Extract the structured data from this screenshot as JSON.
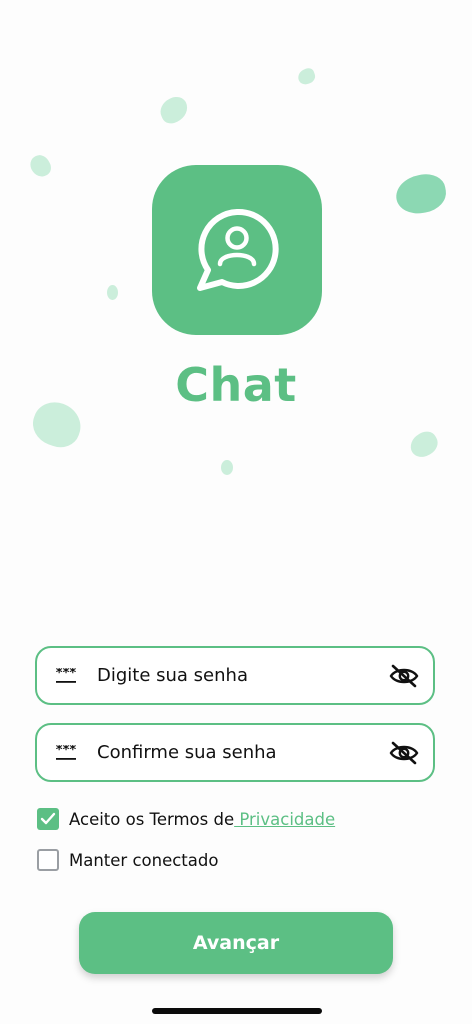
{
  "app": {
    "title": "Chat"
  },
  "form": {
    "password": {
      "placeholder": "Digite sua senha",
      "value": "",
      "icon": "asterisk-key-icon",
      "toggle_icon": "eye-off-icon"
    },
    "confirm_password": {
      "placeholder": "Confirme sua senha",
      "value": "",
      "icon": "asterisk-key-icon",
      "toggle_icon": "eye-off-icon"
    }
  },
  "terms": {
    "checked": true,
    "text": "Aceito os Termos de",
    "link_text": " Privacidade"
  },
  "keep_connected": {
    "checked": false,
    "label": "Manter conectado"
  },
  "submit": {
    "label": "Avançar"
  },
  "colors": {
    "accent": "#5cbf84",
    "blob": "#b9e8cf",
    "background": "#fdfdfd"
  }
}
